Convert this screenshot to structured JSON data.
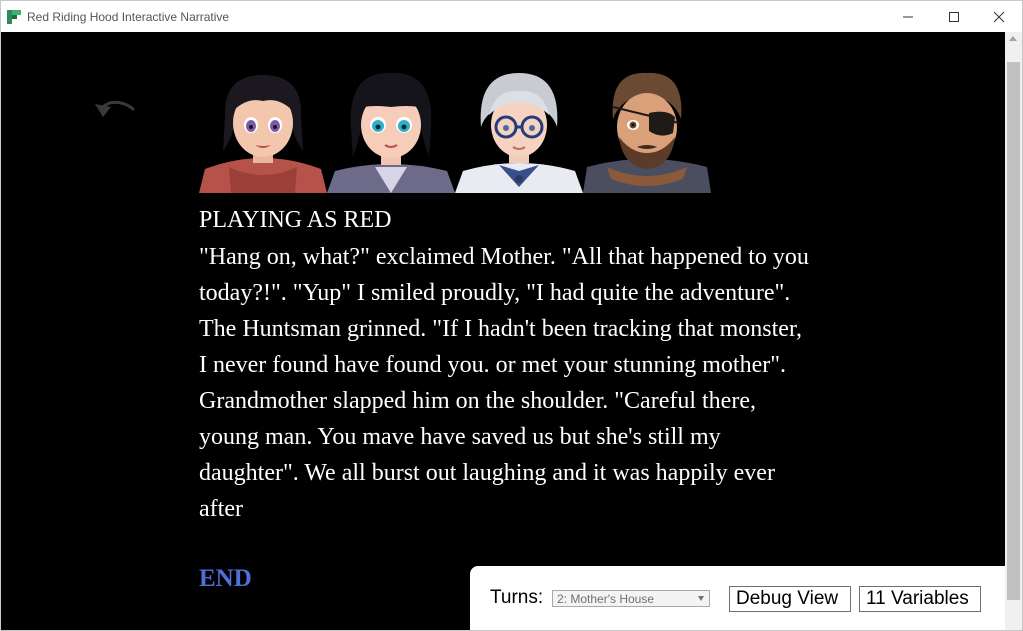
{
  "window": {
    "title": "Red Riding Hood Interactive Narrative"
  },
  "characters": [
    {
      "name": "red-portrait"
    },
    {
      "name": "mother-portrait"
    },
    {
      "name": "grandmother-portrait"
    },
    {
      "name": "huntsman-portrait"
    }
  ],
  "story": {
    "playing_as": "PLAYING AS RED",
    "text": "\"Hang on, what?\" exclaimed Mother. \"All that happened to you today?!\". \"Yup\" I smiled proudly, \"I had quite the adventure\". The Huntsman grinned. \"If I hadn't been tracking that monster, I never found have found you. or met your stunning mother\". Grandmother slapped him on the shoulder. \"Careful there, young man. You mave have saved us but she's still my daughter\". We all burst out laughing and it was happily ever after",
    "end_label": "END"
  },
  "debug": {
    "turns_label": "Turns:",
    "turns_selected": "2: Mother's House",
    "debug_view_label": "Debug View",
    "variables_label": "11 Variables"
  },
  "colors": {
    "background": "#000000",
    "text": "#ffffff",
    "end_link": "#4f6fd6"
  }
}
